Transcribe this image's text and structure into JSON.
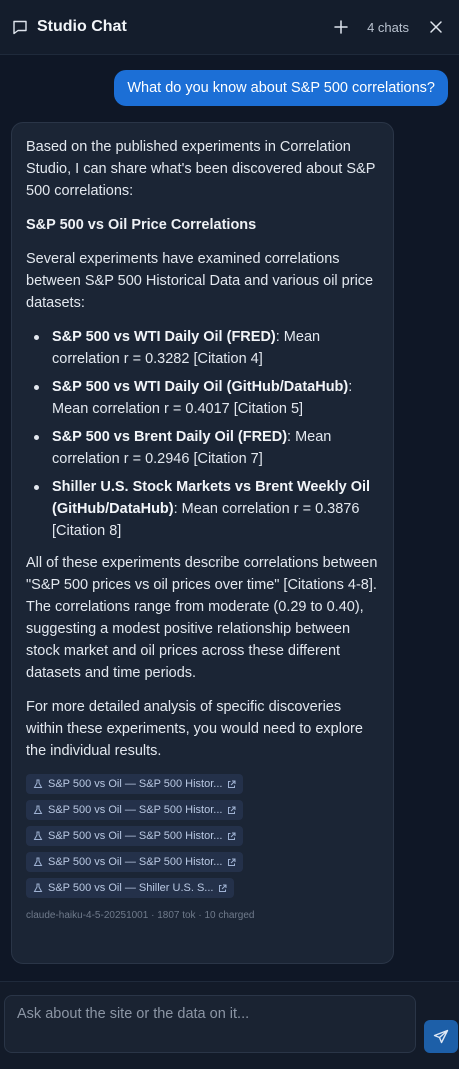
{
  "header": {
    "title": "Studio Chat",
    "chat_count": "4 chats"
  },
  "user_message": "What do you know about S&P 500 correlations?",
  "assistant": {
    "intro": "Based on the published experiments in Correlation Studio, I can share what's been discovered about S&P 500 correlations:",
    "heading": "S&P 500 vs Oil Price Correlations",
    "lead": "Several experiments have examined correlations between S&P 500 Historical Data and various oil price datasets:",
    "items": [
      {
        "bold": "S&P 500 vs WTI Daily Oil (FRED)",
        "text": ": Mean correlation r = 0.3282 [Citation 4]"
      },
      {
        "bold": "S&P 500 vs WTI Daily Oil (GitHub/DataHub)",
        "text": ": Mean correlation r = 0.4017 [Citation 5]"
      },
      {
        "bold": "S&P 500 vs Brent Daily Oil (FRED)",
        "text": ": Mean correlation r = 0.2946 [Citation 7]"
      },
      {
        "bold": "Shiller U.S. Stock Markets vs Brent Weekly Oil (GitHub/DataHub)",
        "text": ": Mean correlation r = 0.3876 [Citation 8]"
      }
    ],
    "summary": "All of these experiments describe correlations between \"S&P 500 prices vs oil prices over time\" [Citations 4-8]. The correlations range from moderate (0.29 to 0.40), suggesting a modest positive relationship between stock market and oil prices across these different datasets and time periods.",
    "closing": "For more detailed analysis of specific discoveries within these experiments, you would need to explore the individual results.",
    "citations": [
      "S&P 500 vs Oil — S&P 500 Histor...",
      "S&P 500 vs Oil — S&P 500 Histor...",
      "S&P 500 vs Oil — S&P 500 Histor...",
      "S&P 500 vs Oil — S&P 500 Histor...",
      "S&P 500 vs Oil — Shiller U.S. S..."
    ],
    "meta": "claude-haiku-4-5-20251001 · 1807 tok · 10 charged"
  },
  "composer": {
    "placeholder": "Ask about the site or the data on it..."
  },
  "icons": {
    "header": "chat-bubble-icon",
    "new_chat": "plus-icon",
    "close": "close-icon",
    "citation": "beaker-icon",
    "external": "external-link-icon",
    "send": "send-icon"
  },
  "colors": {
    "background": "#0f1726",
    "user_bubble": "#1c6fd6",
    "assistant_bubble": "#1b2535",
    "send_button": "#1d5fa8"
  }
}
